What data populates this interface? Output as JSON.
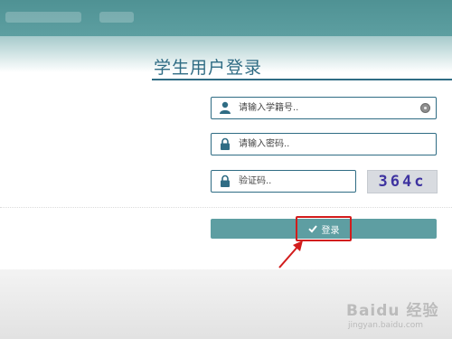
{
  "page": {
    "title": "学生用户登录"
  },
  "form": {
    "student_id_placeholder": "请输入学籍号..",
    "password_placeholder": "请输入密码..",
    "captcha_placeholder": "验证码..",
    "captcha_text": "364c",
    "login_label": "登录"
  },
  "watermark": {
    "brand": "Baidu 经验",
    "site": "jingyan.baidu.com"
  },
  "colors": {
    "accent": "#2f6c84",
    "button": "#5e9ea2",
    "topbar": "#5d9fa1",
    "highlight": "#d21c1c"
  },
  "icons": {
    "user": "user-icon",
    "lock": "lock-icon",
    "clear": "clear-icon",
    "check": "check-icon",
    "arrow": "arrow-icon"
  }
}
